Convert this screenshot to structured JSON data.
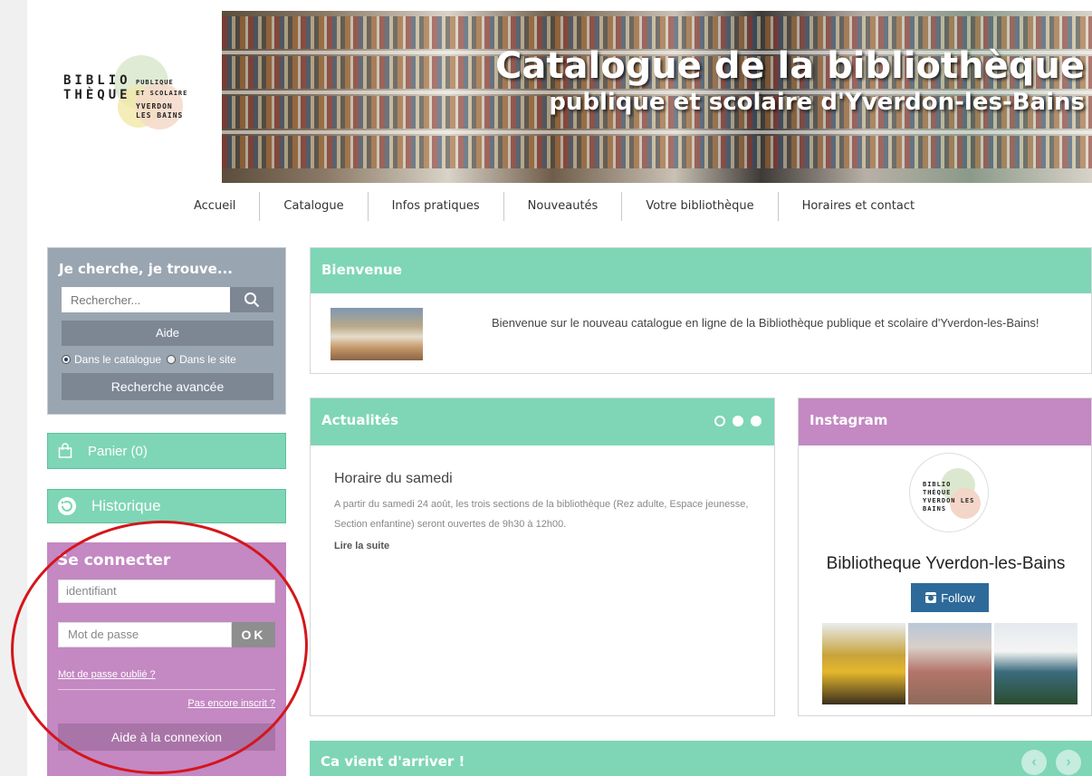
{
  "header": {
    "logo": {
      "line1": "BIBLIO",
      "line2": "THÈQUE",
      "sub1": "PUBLIQUE",
      "sub2": "ET SCOLAIRE",
      "place": "YVERDON LES BAINS"
    },
    "banner_title_1": "Catalogue de la bibliothèque",
    "banner_title_2": "publique et scolaire d'Yverdon-les-Bains"
  },
  "nav": {
    "items": [
      "Accueil",
      "Catalogue",
      "Infos pratiques",
      "Nouveautés",
      "Votre bibliothèque",
      "Horaires et contact"
    ]
  },
  "search": {
    "title": "Je cherche, je trouve...",
    "placeholder": "Rechercher...",
    "help_label": "Aide",
    "scope_catalogue": "Dans le catalogue",
    "scope_site": "Dans le site",
    "selected_scope": "Dans le catalogue",
    "advanced_label": "Recherche avancée"
  },
  "cart": {
    "label": "Panier (0)"
  },
  "history": {
    "label": "Historique"
  },
  "login": {
    "title": "Se connecter",
    "username_placeholder": "identifiant",
    "password_placeholder": "Mot de passe",
    "ok_label": "OK",
    "forgot_label": "Mot de passe oublié ?",
    "register_label": "Pas encore inscrit ?",
    "help_label": "Aide à la connexion"
  },
  "welcome": {
    "title": "Bienvenue",
    "text": "Bienvenue sur le nouveau catalogue en ligne de la Bibliothèque publique et scolaire d'Yverdon-les-Bains!"
  },
  "news": {
    "title": "Actualités",
    "item_title": "Horaire du samedi",
    "item_body": "A partir du samedi 24 août, les trois sections de la bibliothèque (Rez adulte, Espace jeunesse, Section enfantine) seront ouvertes de 9h30 à 12h00.",
    "read_more": "Lire la suite",
    "slides": 3,
    "active_slide": 1
  },
  "instagram": {
    "title": "Instagram",
    "account_name": "Bibliotheque Yverdon-les-Bains",
    "follow_label": "Follow",
    "avatar_text": "BIBLIO THÈQUE YVERDON LES BAINS"
  },
  "new_arrivals": {
    "title": "Ca vient d'arriver !"
  },
  "colors": {
    "teal": "#7ed6b6",
    "purple": "#c488c3",
    "slate": "#9aa5b2",
    "follow_blue": "#2d6a9a",
    "annotation_red": "#d4161b"
  }
}
